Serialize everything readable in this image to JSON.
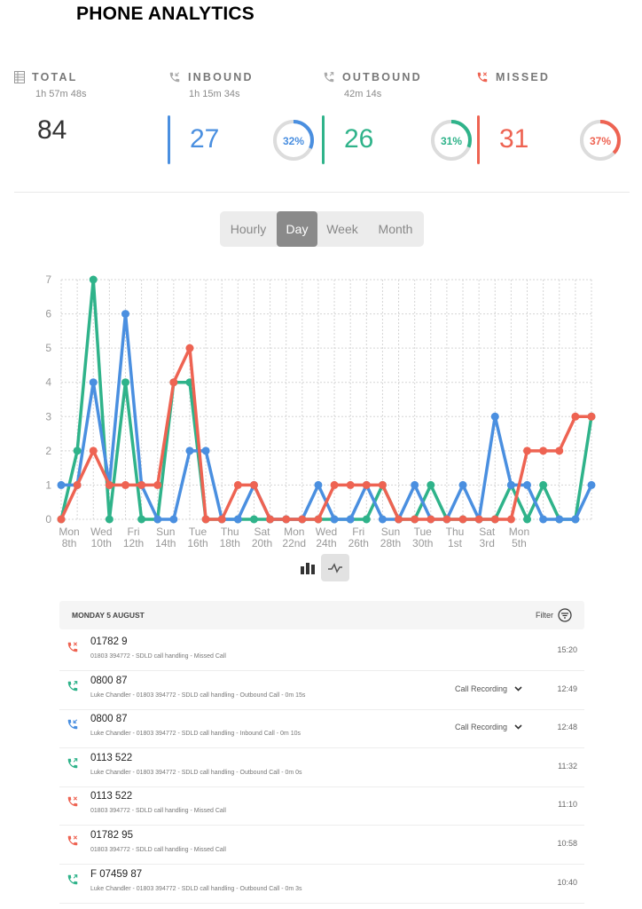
{
  "page_title": "PHONE ANALYTICS",
  "colors": {
    "inbound": "#4a8fe0",
    "outbound": "#2fb38a",
    "missed": "#ee6352",
    "grey": "#d9d9d9"
  },
  "stats": {
    "total": {
      "label": "TOTAL",
      "duration": "1h 57m 48s",
      "count": "84",
      "icon": "table-icon"
    },
    "inbound": {
      "label": "INBOUND",
      "duration": "1h 15m 34s",
      "count": "27",
      "percent": "32%",
      "percent_value": 32,
      "icon": "inbound-phone-icon"
    },
    "outbound": {
      "label": "OUTBOUND",
      "duration": "42m 14s",
      "count": "26",
      "percent": "31%",
      "percent_value": 31,
      "icon": "outbound-phone-icon"
    },
    "missed": {
      "label": "MISSED",
      "count": "31",
      "percent": "37%",
      "percent_value": 37,
      "icon": "missed-phone-icon"
    }
  },
  "range_tabs": [
    {
      "label": "Hourly",
      "active": false
    },
    {
      "label": "Day",
      "active": true
    },
    {
      "label": "Week",
      "active": false
    },
    {
      "label": "Month",
      "active": false
    }
  ],
  "chart_data": {
    "type": "line",
    "ylim": [
      0,
      7
    ],
    "y_ticks": [
      "0",
      "1",
      "2",
      "3",
      "4",
      "5",
      "6",
      "7"
    ],
    "x_tick_labels": [
      [
        "Mon",
        "8th"
      ],
      [
        "Wed",
        "10th"
      ],
      [
        "Fri",
        "12th"
      ],
      [
        "Sun",
        "14th"
      ],
      [
        "Tue",
        "16th"
      ],
      [
        "Thu",
        "18th"
      ],
      [
        "Sat",
        "20th"
      ],
      [
        "Mon",
        "22nd"
      ],
      [
        "Wed",
        "24th"
      ],
      [
        "Fri",
        "26th"
      ],
      [
        "Sun",
        "28th"
      ],
      [
        "Tue",
        "30th"
      ],
      [
        "Thu",
        "1st"
      ],
      [
        "Sat",
        "3rd"
      ],
      [
        "Mon",
        "5th"
      ]
    ],
    "grid": true,
    "series": [
      {
        "key": "outbound",
        "color": "#2fb38a",
        "values": [
          0,
          2,
          7,
          0,
          4,
          0,
          0,
          4,
          4,
          0,
          0,
          0,
          0,
          0,
          0,
          0,
          0,
          0,
          0,
          0,
          1,
          0,
          0,
          1,
          0,
          0,
          0,
          0,
          1,
          0,
          1,
          0,
          0,
          3
        ]
      },
      {
        "key": "inbound",
        "color": "#4a8fe0",
        "values": [
          1,
          1,
          4,
          1,
          6,
          1,
          0,
          0,
          2,
          2,
          0,
          0,
          1,
          0,
          0,
          0,
          1,
          0,
          0,
          1,
          0,
          0,
          1,
          0,
          0,
          1,
          0,
          3,
          1,
          1,
          0,
          0,
          0,
          1
        ]
      },
      {
        "key": "missed",
        "color": "#ee6352",
        "values": [
          0,
          1,
          2,
          1,
          1,
          1,
          1,
          4,
          5,
          0,
          0,
          1,
          1,
          0,
          0,
          0,
          0,
          1,
          1,
          1,
          1,
          0,
          0,
          0,
          0,
          0,
          0,
          0,
          0,
          2,
          2,
          2,
          3,
          3
        ]
      }
    ]
  },
  "view_toggle": {
    "bar_icon": "bar-chart-icon",
    "line_icon": "line-chart-icon"
  },
  "call_list": {
    "date_header": "MONDAY 5 AUGUST",
    "filter_label": "Filter",
    "calls": [
      {
        "type": "missed",
        "number": "01782 9",
        "detail": "01803 394772 - SDLD call handling - Missed Call",
        "recording": "",
        "time": "15:20"
      },
      {
        "type": "outbound",
        "number": "0800 87",
        "detail": "Luke Chandler - 01803 394772 - SDLD call handling - Outbound Call - 0m 15s",
        "recording": "Call Recording",
        "time": "12:49"
      },
      {
        "type": "inbound",
        "number": "0800 87",
        "detail": "Luke Chandler - 01803 394772 - SDLD call handling - Inbound Call - 0m 10s",
        "recording": "Call Recording",
        "time": "12:48"
      },
      {
        "type": "outbound",
        "number": "0113 522",
        "detail": "Luke Chandler - 01803 394772 - SDLD call handling - Outbound Call - 0m 0s",
        "recording": "",
        "time": "11:32"
      },
      {
        "type": "missed",
        "number": "0113 522",
        "detail": "01803 394772 - SDLD call handling - Missed Call",
        "recording": "",
        "time": "11:10"
      },
      {
        "type": "missed",
        "number": "01782 95",
        "detail": "01803 394772 - SDLD call handling - Missed Call",
        "recording": "",
        "time": "10:58"
      },
      {
        "type": "outbound",
        "number": "F                        07459 87",
        "detail": "Luke Chandler - 01803 394772 - SDLD call handling - Outbound Call - 0m 3s",
        "recording": "",
        "time": "10:40"
      }
    ]
  }
}
